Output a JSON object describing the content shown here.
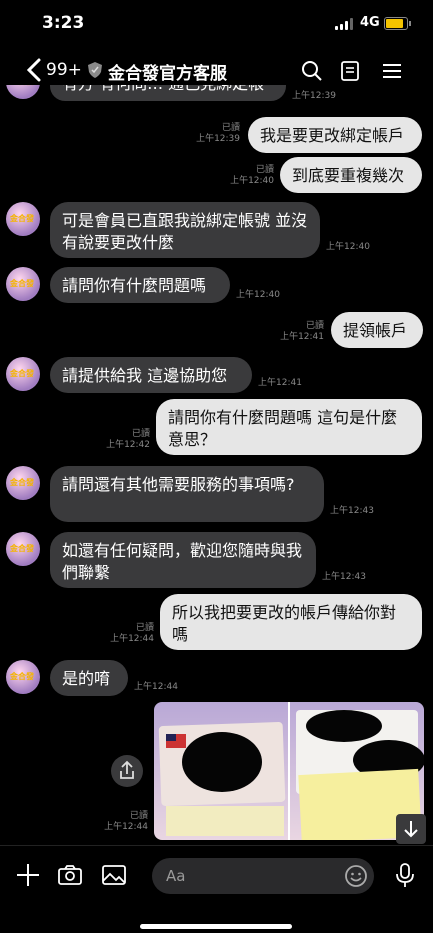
{
  "status": {
    "time": "3:23",
    "network": "4G"
  },
  "header": {
    "back_count": "99+",
    "title": "金合發官方客服"
  },
  "messages": {
    "m0": {
      "text": "有方 有何問… 通己見綁定帳",
      "time": "上午12:39"
    },
    "m1": {
      "text": "我是要更改綁定帳戶",
      "read": "已讀",
      "time": "上午12:39"
    },
    "m2": {
      "text": "到底要重複幾次",
      "read": "已讀",
      "time": "上午12:40"
    },
    "m3": {
      "text": "可是會員已直跟我說綁定帳號 並沒有說要更改什麼",
      "time": "上午12:40"
    },
    "m4": {
      "text": "請問你有什麼問題嗎",
      "time": "上午12:40"
    },
    "m5": {
      "text": "提領帳戶",
      "read": "已讀",
      "time": "上午12:41"
    },
    "m6": {
      "text": "請提供給我 這邊協助您",
      "time": "上午12:41"
    },
    "m7": {
      "text": "請問你有什麼問題嗎 這句是什麼意思？",
      "read": "已讀",
      "time": "上午12:42"
    },
    "m8": {
      "text": "請問還有其他需要服務的事項嗎?",
      "time": "上午12:43"
    },
    "m9": {
      "text": "如還有任何疑問，歡迎您隨時與我們聯繫",
      "time": "上午12:43"
    },
    "m10": {
      "text": "所以我把要更改的帳戶傳給你對嗎",
      "read": "已讀",
      "time": "上午12:44"
    },
    "m11": {
      "text": "是的唷",
      "time": "上午12:44"
    },
    "m12": {
      "read": "已讀",
      "time": "上午12:44"
    }
  },
  "avatar_label": "金合發",
  "input": {
    "placeholder": "Aa"
  },
  "colors": {
    "bubble_in": "#3a3a3c",
    "bubble_out": "#e6e6e6",
    "battery": "#f5c400"
  }
}
